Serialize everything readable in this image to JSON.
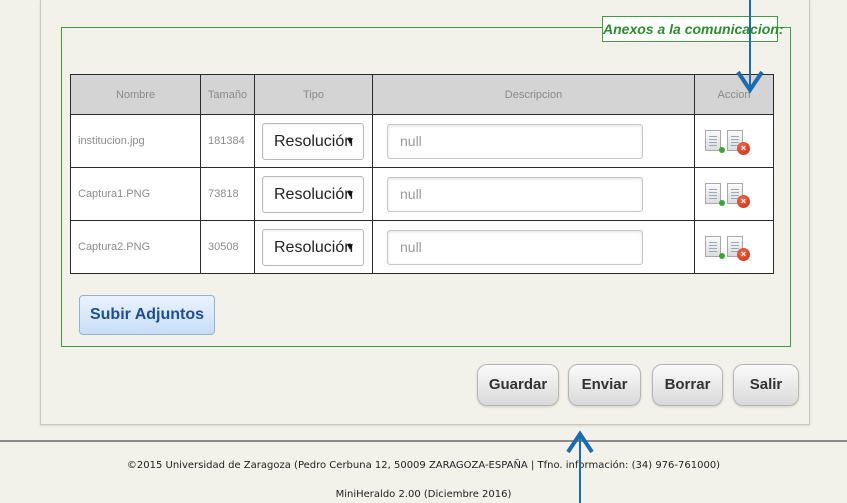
{
  "legend": "Anexos a la comunicacion:",
  "table": {
    "headers": [
      "Nombre",
      "Tamaño",
      "Tipo",
      "Descripcion",
      "Accion"
    ],
    "rows": [
      {
        "nombre": "institucion.jpg",
        "tamano": "181384",
        "tipo": "Resolución",
        "descripcion": "null"
      },
      {
        "nombre": "Captura1.PNG",
        "tamano": "73818",
        "tipo": "Resolución",
        "descripcion": "null"
      },
      {
        "nombre": "Captura2.PNG",
        "tamano": "30508",
        "tipo": "Resolución",
        "descripcion": "null"
      }
    ]
  },
  "buttons": {
    "subir": "Subir Adjuntos",
    "guardar": "Guardar",
    "enviar": "Enviar",
    "borrar": "Borrar",
    "salir": "Salir"
  },
  "footer": {
    "line1": "©2015 Universidad de Zaragoza (Pedro Cerbuna 12, 50009 ZARAGOZA-ESPAÑA | Tfno. información: (34) 976-761000)",
    "line2": "MiniHeraldo 2.00 (Diciembre 2016)"
  },
  "colors": {
    "fieldset_border": "#3d9a3d",
    "legend_text": "#2e8b2e",
    "annotation_arrow": "#1a6bb0"
  },
  "icons": [
    "file-download-icon",
    "file-delete-icon",
    "select-caret-icon",
    "annotation-arrow-icon"
  ]
}
